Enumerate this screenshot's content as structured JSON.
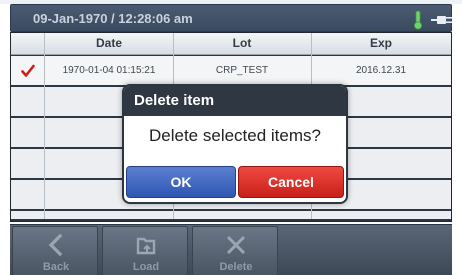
{
  "status_bar": {
    "datetime": "09-Jan-1970 / 12:28:06 am",
    "thermometer_icon": "thermometer-icon",
    "power_icon": "power-plug-icon"
  },
  "table": {
    "columns": [
      "Date",
      "Lot",
      "Exp"
    ],
    "rows": [
      {
        "selected": true,
        "date": "1970-01-04 01:15:21",
        "lot": "CRP_TEST",
        "exp": "2016.12.31"
      },
      {
        "selected": false,
        "date": "",
        "lot": "",
        "exp": ""
      },
      {
        "selected": false,
        "date": "",
        "lot": "",
        "exp": ""
      },
      {
        "selected": false,
        "date": "",
        "lot": "",
        "exp": ""
      },
      {
        "selected": false,
        "date": "",
        "lot": "",
        "exp": ""
      },
      {
        "selected": false,
        "date": "",
        "lot": "",
        "exp": ""
      }
    ]
  },
  "dialog": {
    "title": "Delete item",
    "message": "Delete selected items?",
    "ok_label": "OK",
    "cancel_label": "Cancel"
  },
  "toolbar": {
    "buttons": [
      {
        "label": "Back",
        "icon": "chevron-left-icon"
      },
      {
        "label": "Load",
        "icon": "load-icon"
      },
      {
        "label": "Delete",
        "icon": "delete-x-icon"
      }
    ]
  },
  "colors": {
    "check": "#cc1f1a",
    "ok_button": "#3a62c0",
    "cancel_button": "#dc322b",
    "status_bar": "#3f4f64"
  }
}
